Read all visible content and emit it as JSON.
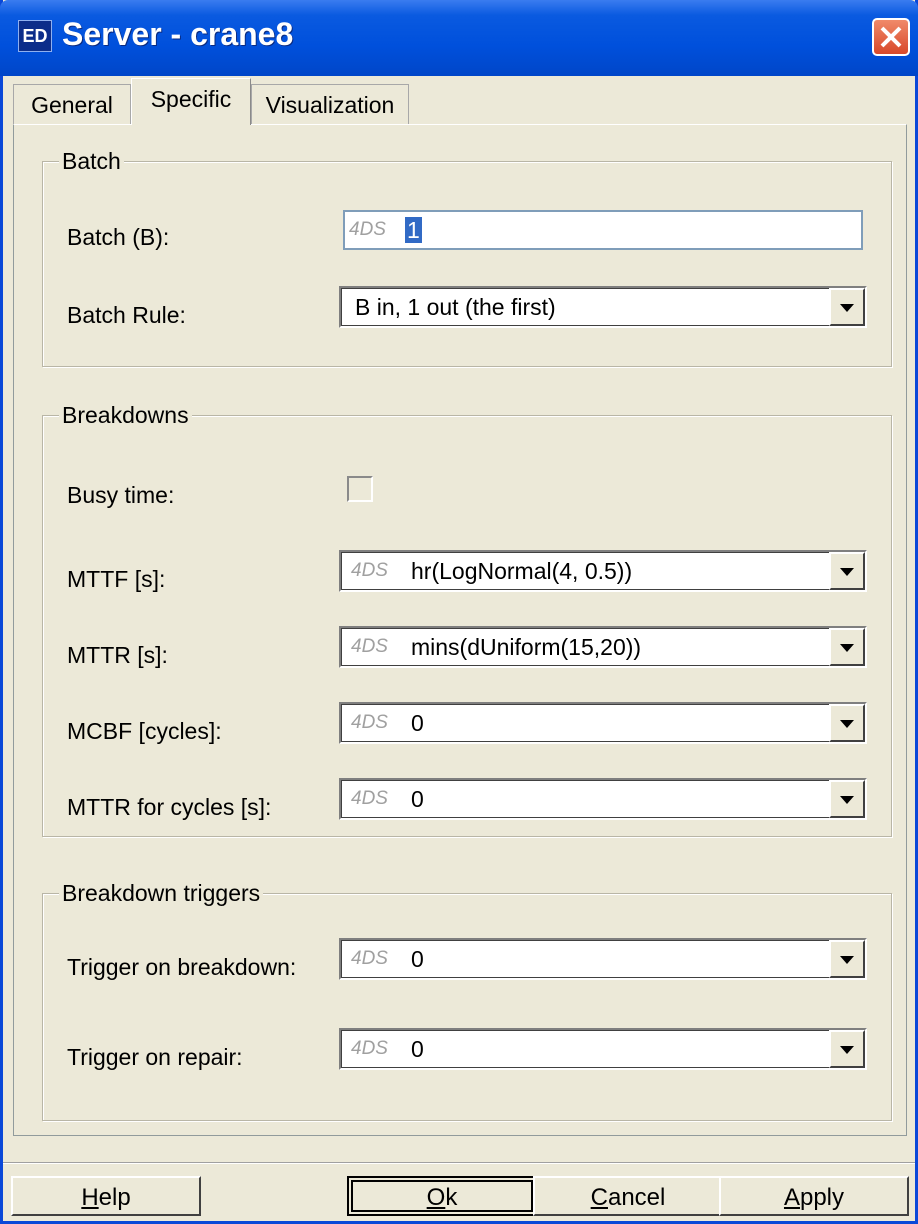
{
  "window": {
    "icon_text": "ED",
    "title": "Server - crane8",
    "close_icon": "close-x-icon",
    "accent": "#0050dc"
  },
  "tabs": [
    {
      "label": "General",
      "active": false
    },
    {
      "label": "Specific",
      "active": true
    },
    {
      "label": "Visualization",
      "active": false
    }
  ],
  "batch": {
    "group_title": "Batch",
    "batch_label": "Batch (B):",
    "batch_prefix": "4DS",
    "batch_value": "1",
    "rule_label": "Batch Rule:",
    "rule_value": "B in, 1 out (the first)"
  },
  "breakdowns": {
    "group_title": "Breakdowns",
    "busy_label": "Busy time:",
    "busy_checked": false,
    "mttf_label": "MTTF [s]:",
    "mttf_prefix": "4DS",
    "mttf_value": "hr(LogNormal(4, 0.5))",
    "mttr_label": "MTTR [s]:",
    "mttr_prefix": "4DS",
    "mttr_value": "mins(dUniform(15,20))",
    "mcbf_label": "MCBF [cycles]:",
    "mcbf_prefix": "4DS",
    "mcbf_value": "0",
    "mttrc_label": "MTTR for cycles [s]:",
    "mttrc_prefix": "4DS",
    "mttrc_value": "0"
  },
  "triggers": {
    "group_title": "Breakdown triggers",
    "tb_label": "Trigger on breakdown:",
    "tb_prefix": "4DS",
    "tb_value": "0",
    "tr_label": "Trigger on repair:",
    "tr_prefix": "4DS",
    "tr_value": "0"
  },
  "buttons": {
    "help_first": "H",
    "help_rest": "elp",
    "ok_first": "O",
    "ok_rest": "k",
    "cancel_first": "C",
    "cancel_rest": "ancel",
    "apply_first": "A",
    "apply_rest": "pply"
  }
}
